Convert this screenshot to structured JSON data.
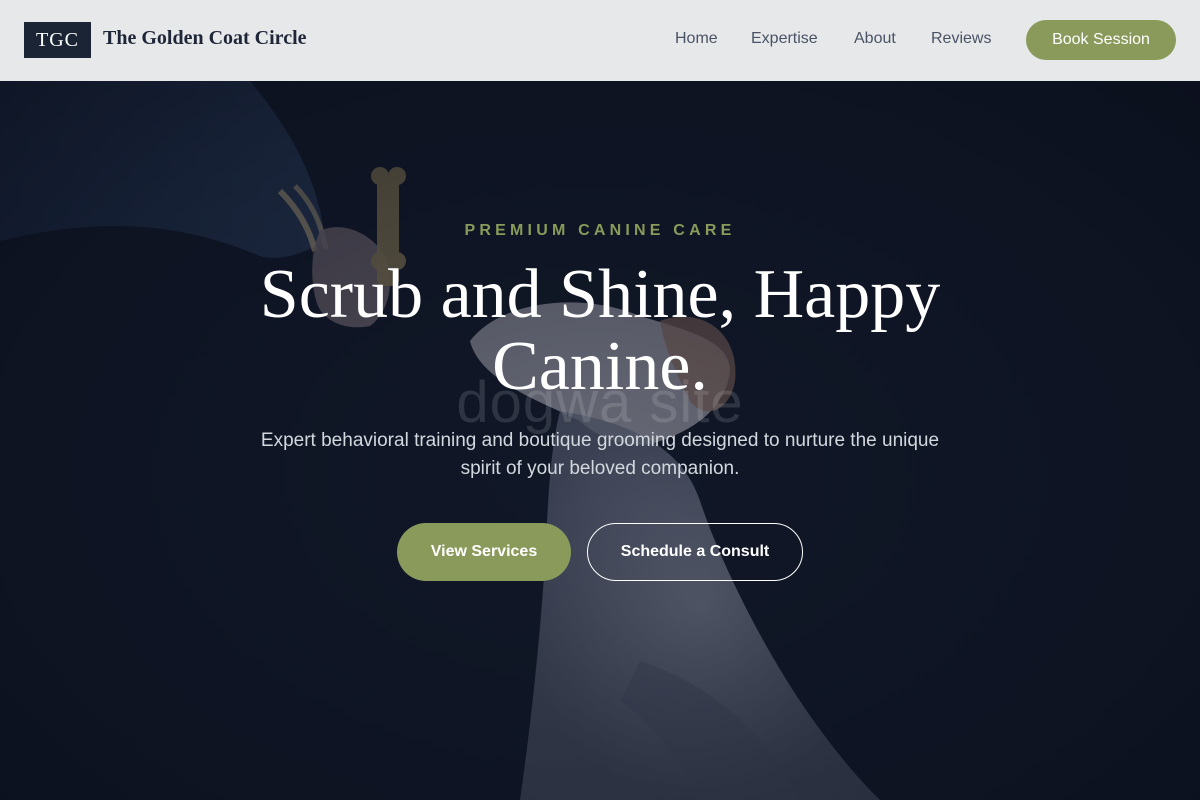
{
  "header": {
    "logo_text": "TGC",
    "brand_name": "The Golden Coat Circle",
    "nav": [
      {
        "label": "Home"
      },
      {
        "label": "Expertise"
      },
      {
        "label": "About"
      },
      {
        "label": "Reviews"
      }
    ],
    "cta_label": "Book Session"
  },
  "hero": {
    "eyebrow": "PREMIUM CANINE CARE",
    "headline": "Scrub and Shine, Happy Canine.",
    "watermark": "dogwa    site",
    "subtext": "Expert behavioral training and boutique grooming designed to nurture the unique spirit of your beloved companion.",
    "primary_button": "View Services",
    "secondary_button": "Schedule a Consult",
    "image_subject": "hand offering a bone-shaped treat to a white dog against a dark background"
  },
  "colors": {
    "accent": "#8a9a5b",
    "dark": "#1b2435",
    "header_bg": "#e7e8ea",
    "hero_bg": "#101727"
  }
}
